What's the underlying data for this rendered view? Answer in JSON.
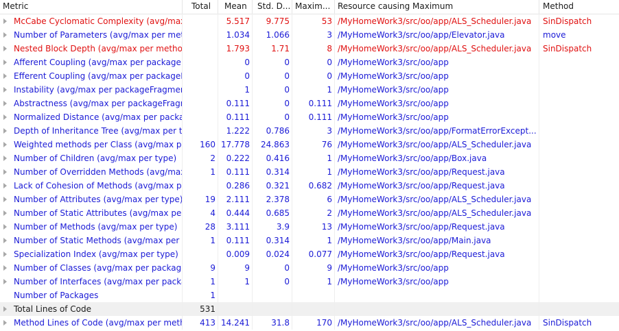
{
  "colors": {
    "link": "#1a1ad6",
    "warning": "#e01010",
    "plain": "#1a1a1a",
    "separator": "#e5e5e5",
    "gray_row": "#f0f0f0"
  },
  "columns": {
    "metric": "Metric",
    "total": "Total",
    "mean": "Mean",
    "std_dev": "Std. D...",
    "maximum": "Maxim...",
    "resource": "Resource causing Maximum",
    "method": "Method"
  },
  "rows": [
    {
      "metric": "McCabe Cyclomatic Complexity (avg/max",
      "total": "",
      "mean": "5.517",
      "std": "9.775",
      "max": "53",
      "resource": "/MyHomeWork3/src/oo/app/ALS_Scheduler.java",
      "method": "SinDispatch",
      "color": "red",
      "expandable": true
    },
    {
      "metric": "Number of Parameters (avg/max per meth",
      "total": "",
      "mean": "1.034",
      "std": "1.066",
      "max": "3",
      "resource": "/MyHomeWork3/src/oo/app/Elevator.java",
      "method": "move",
      "color": "blue",
      "expandable": true
    },
    {
      "metric": "Nested Block Depth (avg/max per methoc",
      "total": "",
      "mean": "1.793",
      "std": "1.71",
      "max": "8",
      "resource": "/MyHomeWork3/src/oo/app/ALS_Scheduler.java",
      "method": "SinDispatch",
      "color": "red",
      "expandable": true
    },
    {
      "metric": "Afferent Coupling (avg/max per packageF",
      "total": "",
      "mean": "0",
      "std": "0",
      "max": "0",
      "resource": "/MyHomeWork3/src/oo/app",
      "method": "",
      "color": "blue",
      "expandable": true
    },
    {
      "metric": "Efferent Coupling (avg/max per packageFi",
      "total": "",
      "mean": "0",
      "std": "0",
      "max": "0",
      "resource": "/MyHomeWork3/src/oo/app",
      "method": "",
      "color": "blue",
      "expandable": true
    },
    {
      "metric": "Instability (avg/max per packageFragment",
      "total": "",
      "mean": "1",
      "std": "0",
      "max": "1",
      "resource": "/MyHomeWork3/src/oo/app",
      "method": "",
      "color": "blue",
      "expandable": true
    },
    {
      "metric": "Abstractness (avg/max per packageFragm",
      "total": "",
      "mean": "0.111",
      "std": "0",
      "max": "0.111",
      "resource": "/MyHomeWork3/src/oo/app",
      "method": "",
      "color": "blue",
      "expandable": true
    },
    {
      "metric": "Normalized Distance (avg/max per packag",
      "total": "",
      "mean": "0.111",
      "std": "0",
      "max": "0.111",
      "resource": "/MyHomeWork3/src/oo/app",
      "method": "",
      "color": "blue",
      "expandable": true
    },
    {
      "metric": "Depth of Inheritance Tree (avg/max per ty",
      "total": "",
      "mean": "1.222",
      "std": "0.786",
      "max": "3",
      "resource": "/MyHomeWork3/src/oo/app/FormatErrorExcept...",
      "method": "",
      "color": "blue",
      "expandable": true
    },
    {
      "metric": "Weighted methods per Class (avg/max pe",
      "total": "160",
      "mean": "17.778",
      "std": "24.863",
      "max": "76",
      "resource": "/MyHomeWork3/src/oo/app/ALS_Scheduler.java",
      "method": "",
      "color": "blue",
      "expandable": true
    },
    {
      "metric": "Number of Children (avg/max per type)",
      "total": "2",
      "mean": "0.222",
      "std": "0.416",
      "max": "1",
      "resource": "/MyHomeWork3/src/oo/app/Box.java",
      "method": "",
      "color": "blue",
      "expandable": true
    },
    {
      "metric": "Number of Overridden Methods (avg/max",
      "total": "1",
      "mean": "0.111",
      "std": "0.314",
      "max": "1",
      "resource": "/MyHomeWork3/src/oo/app/Request.java",
      "method": "",
      "color": "blue",
      "expandable": true
    },
    {
      "metric": "Lack of Cohesion of Methods (avg/max pe",
      "total": "",
      "mean": "0.286",
      "std": "0.321",
      "max": "0.682",
      "resource": "/MyHomeWork3/src/oo/app/Request.java",
      "method": "",
      "color": "blue",
      "expandable": true
    },
    {
      "metric": "Number of Attributes (avg/max per type)",
      "total": "19",
      "mean": "2.111",
      "std": "2.378",
      "max": "6",
      "resource": "/MyHomeWork3/src/oo/app/ALS_Scheduler.java",
      "method": "",
      "color": "blue",
      "expandable": true
    },
    {
      "metric": "Number of Static Attributes (avg/max per",
      "total": "4",
      "mean": "0.444",
      "std": "0.685",
      "max": "2",
      "resource": "/MyHomeWork3/src/oo/app/ALS_Scheduler.java",
      "method": "",
      "color": "blue",
      "expandable": true
    },
    {
      "metric": "Number of Methods (avg/max per type)",
      "total": "28",
      "mean": "3.111",
      "std": "3.9",
      "max": "13",
      "resource": "/MyHomeWork3/src/oo/app/Request.java",
      "method": "",
      "color": "blue",
      "expandable": true
    },
    {
      "metric": "Number of Static Methods (avg/max per t",
      "total": "1",
      "mean": "0.111",
      "std": "0.314",
      "max": "1",
      "resource": "/MyHomeWork3/src/oo/app/Main.java",
      "method": "",
      "color": "blue",
      "expandable": true
    },
    {
      "metric": "Specialization Index (avg/max per type)",
      "total": "",
      "mean": "0.009",
      "std": "0.024",
      "max": "0.077",
      "resource": "/MyHomeWork3/src/oo/app/Request.java",
      "method": "",
      "color": "blue",
      "expandable": true
    },
    {
      "metric": "Number of Classes (avg/max per package",
      "total": "9",
      "mean": "9",
      "std": "0",
      "max": "9",
      "resource": "/MyHomeWork3/src/oo/app",
      "method": "",
      "color": "blue",
      "expandable": true
    },
    {
      "metric": "Number of Interfaces (avg/max per packa",
      "total": "1",
      "mean": "1",
      "std": "0",
      "max": "1",
      "resource": "/MyHomeWork3/src/oo/app",
      "method": "",
      "color": "blue",
      "expandable": true
    },
    {
      "metric": "Number of Packages",
      "total": "1",
      "mean": "",
      "std": "",
      "max": "",
      "resource": "",
      "method": "",
      "color": "blue",
      "expandable": false
    },
    {
      "metric": "Total Lines of Code",
      "total": "531",
      "mean": "",
      "std": "",
      "max": "",
      "resource": "",
      "method": "",
      "color": "plain",
      "expandable": true,
      "shaded": true
    },
    {
      "metric": "Method Lines of Code (avg/max per meth",
      "total": "413",
      "mean": "14.241",
      "std": "31.8",
      "max": "170",
      "resource": "/MyHomeWork3/src/oo/app/ALS_Scheduler.java",
      "method": "SinDispatch",
      "color": "blue",
      "expandable": true
    }
  ]
}
